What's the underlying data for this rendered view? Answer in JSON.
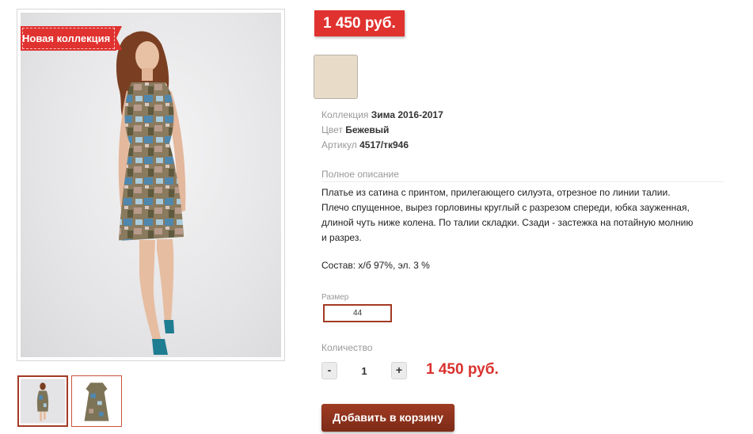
{
  "gallery": {
    "ribbon_label": "Новая коллекция",
    "images": [
      {
        "name": "model-front-photo",
        "active": true
      },
      {
        "name": "dress-flat-photo",
        "active": false
      }
    ]
  },
  "product": {
    "price_badge": "1 450 руб.",
    "swatch_color": "#e8dcc9",
    "properties": [
      {
        "label": "Коллекция",
        "value": "Зима 2016-2017"
      },
      {
        "label": "Цвет",
        "value": "Бежевый"
      },
      {
        "label": "Артикул",
        "value": "4517/тк946"
      }
    ],
    "description_heading": "Полное описание",
    "description_lines": [
      "Платье из сатина с принтом,  прилегающего силуэта, отрезное по линии  талии.",
      "Плечо спущенное, вырез горловины круглый с разрезом спереди, юбка зауженная,",
      "длиной чуть ниже колена. По талии складки. Сзади - застежка на потайную молнию",
      "и разрез."
    ],
    "composition": "Состав: х/б 97%, эл. 3 %"
  },
  "size": {
    "label": "Размер",
    "selected": "44"
  },
  "quantity": {
    "label": "Количество",
    "minus": "-",
    "value": "1",
    "plus": "+"
  },
  "total_price": "1 450 руб.",
  "add_to_cart_label": "Добавить в корзину",
  "colors": {
    "accent_red": "#e0322f",
    "button_brown": "#8e3420",
    "border_brown": "#a33a24"
  }
}
